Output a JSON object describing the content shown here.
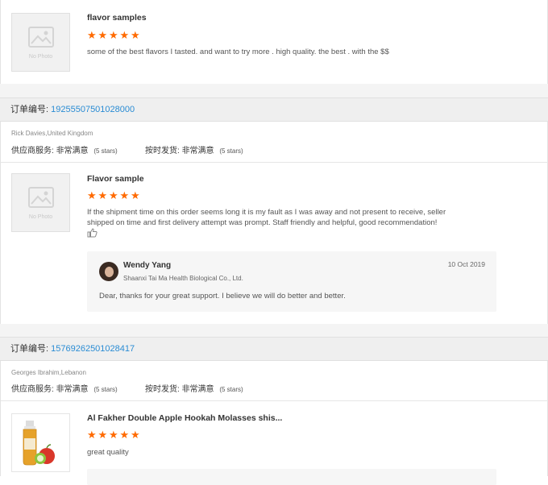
{
  "reviews": [
    {
      "title": "flavor samples",
      "rating_stars": 5,
      "text": "some of the best flavors  I tasted.  and want to try  more . high quality.  the best . with the $$",
      "photo_placeholder": "No Photo"
    },
    {
      "order_label": "订单编号:",
      "order_number": "19255507501028000",
      "buyer": "Rick Davies,United Kingdom",
      "supplier_service_label": "供应商服务:",
      "supplier_service_value": "非常满意",
      "supplier_service_stars": "(5 stars)",
      "on_time_label": "按时发货:",
      "on_time_value": "非常满意",
      "on_time_stars": "(5 stars)",
      "title": "Flavor sample",
      "rating_stars": 5,
      "text": "If the shipment time on this order seems long it is my fault as I was away and not present to receive, seller shipped on time and first delivery attempt was prompt. Staff friendly and helpful, good recommendation!",
      "photo_placeholder": "No Photo",
      "reply": {
        "name": "Wendy Yang",
        "company": "Shaanxi Tai Ma Health Biological Co., Ltd.",
        "date": "10 Oct 2019",
        "message": "Dear, thanks for your great support. I believe we will do better and better."
      }
    },
    {
      "order_label": "订单编号:",
      "order_number": "15769262501028417",
      "buyer": "Georges Ibrahim,Lebanon",
      "supplier_service_label": "供应商服务:",
      "supplier_service_value": "非常满意",
      "supplier_service_stars": "(5 stars)",
      "on_time_label": "按时发货:",
      "on_time_value": "非常满意",
      "on_time_stars": "(5 stars)",
      "title": "Al Fakher Double Apple Hookah Molasses shis...",
      "rating_stars": 5,
      "text": "great quality",
      "product_image_icon": "apple-bottle-image"
    }
  ],
  "colors": {
    "star": "#ff6a00",
    "order_number": "#2a8cd4",
    "bar_bg": "#efefef"
  },
  "icons": {
    "thumb": "thumbs-up-icon",
    "nophoto": "image-placeholder-icon"
  }
}
